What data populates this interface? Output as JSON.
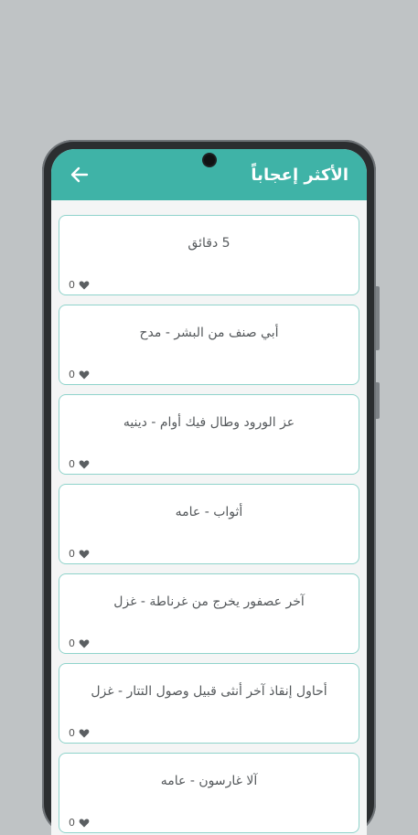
{
  "appbar": {
    "title": "الأكثر إعجاباً",
    "back_icon": "arrow-left-icon",
    "color": "#3fb3a7"
  },
  "items": [
    {
      "title": "5 دقائق",
      "likes": "0"
    },
    {
      "title": "أبي صنف من البشر - مدح",
      "likes": "0"
    },
    {
      "title": "عز الورود وطال فيك أوام - دينيه",
      "likes": "0"
    },
    {
      "title": "أثواب - عامه",
      "likes": "0"
    },
    {
      "title": "آخر عصفور يخرج من غرناطة - غزل",
      "likes": "0"
    },
    {
      "title": "أحاول إنقاذ آخر أنثى قبيل وصول التتار - غزل",
      "likes": "0"
    },
    {
      "title": "آلا غارسون - عامه",
      "likes": "0"
    }
  ]
}
